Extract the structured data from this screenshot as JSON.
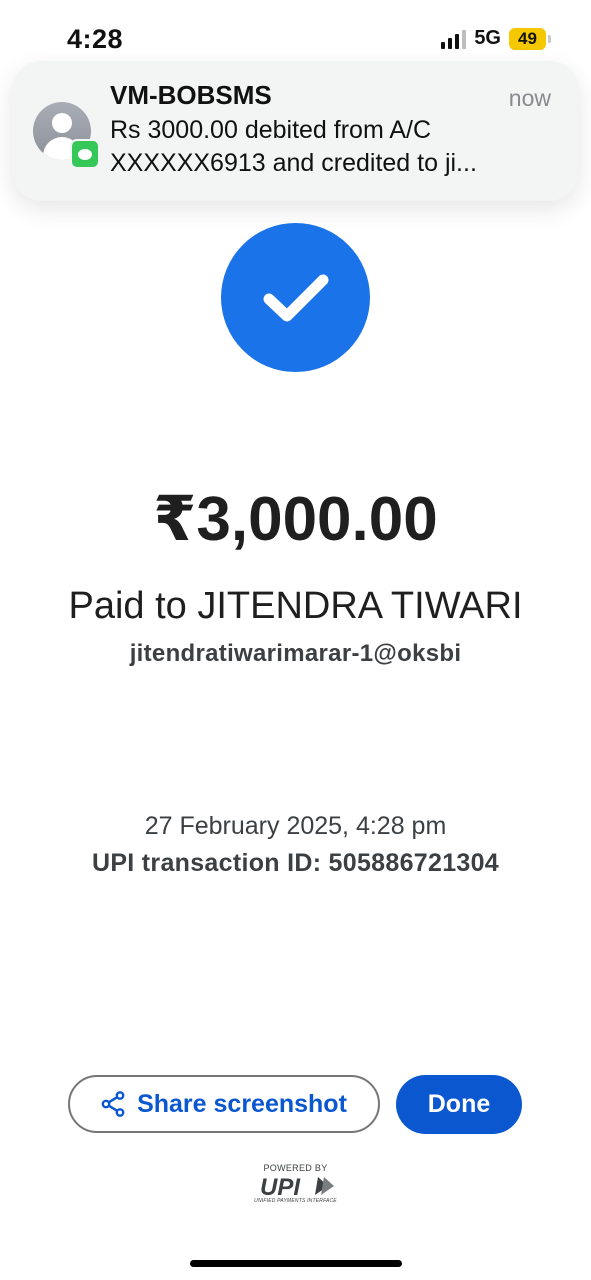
{
  "status_bar": {
    "time": "4:28",
    "network": "5G",
    "battery": "49",
    "battery_color": "#f5c800"
  },
  "notification": {
    "app_icon": "messages-icon",
    "sender": "VM-BOBSMS",
    "time": "now",
    "line1": "Rs 3000.00 debited from A/C",
    "line2": "XXXXXX6913 and credited to ji..."
  },
  "payment": {
    "status_icon": "check-icon",
    "accent_color": "#1a73e8",
    "amount": "₹3,000.00",
    "paid_to": "Paid to JITENDRA TIWARI",
    "upi_id": "jitendratiwarimarar-1@oksbi",
    "datetime": "27 February 2025, 4:28 pm",
    "transaction": "UPI transaction ID: 505886721304"
  },
  "actions": {
    "share_label": "Share screenshot",
    "share_icon": "share-icon",
    "done_label": "Done",
    "primary_color": "#0b57d0"
  },
  "footer": {
    "powered_by": "POWERED BY",
    "logo_text": "UPI",
    "logo_subtitle": "UNIFIED PAYMENTS INTERFACE"
  }
}
